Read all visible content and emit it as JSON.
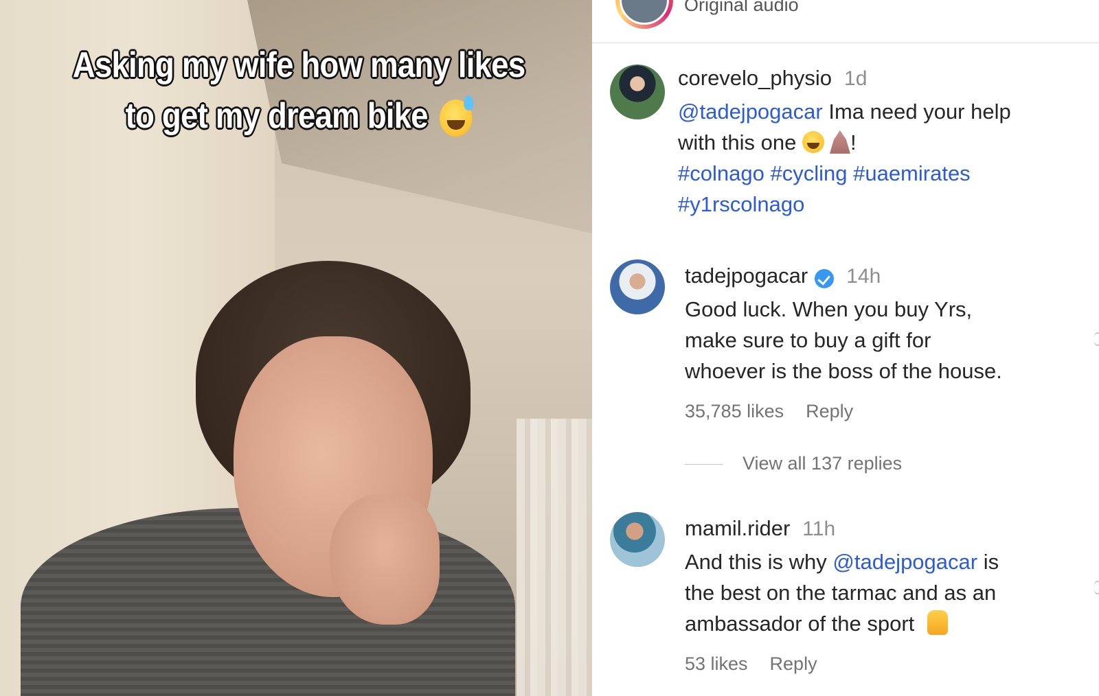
{
  "video": {
    "overlay_line1": "Asking my wife how many likes",
    "overlay_line2": "to get my dream bike",
    "overlay_emoji": "sweat-smile-emoji"
  },
  "audio": {
    "label": "Original audio"
  },
  "comments": [
    {
      "username": "corevelo_physio",
      "time": "1d",
      "mention": "@tadejpogacar",
      "text_a": " Ima need your help",
      "text_b": "with this one ",
      "text_end": "!",
      "tags_line1": [
        "#colnago",
        "#cycling",
        "#uaemirates"
      ],
      "tags_line2": [
        "#y1rscolnago"
      ],
      "emojis": [
        "sweat-smile-emoji",
        "pray-emoji"
      ]
    },
    {
      "username": "tadejpogacar",
      "verified": true,
      "time": "14h",
      "line1": "Good luck. When you buy Yrs,",
      "line2": "make sure to buy a gift for",
      "line3": "whoever is the boss of the house.",
      "likes": "35,785 likes",
      "reply": "Reply",
      "view_replies": "View all 137 replies"
    },
    {
      "username": "mamil.rider",
      "time": "11h",
      "line1_a": "And this is why ",
      "mention": "@tadejpogacar",
      "line1_b": " is",
      "line2": "the best on the tarmac and as an",
      "line3": "ambassador of the sport ",
      "emoji": "thumbs-up-emoji",
      "likes": "53 likes",
      "reply": "Reply"
    }
  ],
  "colors": {
    "link": "#2b5bd8",
    "muted": "#737373",
    "verified": "#3897f0"
  }
}
